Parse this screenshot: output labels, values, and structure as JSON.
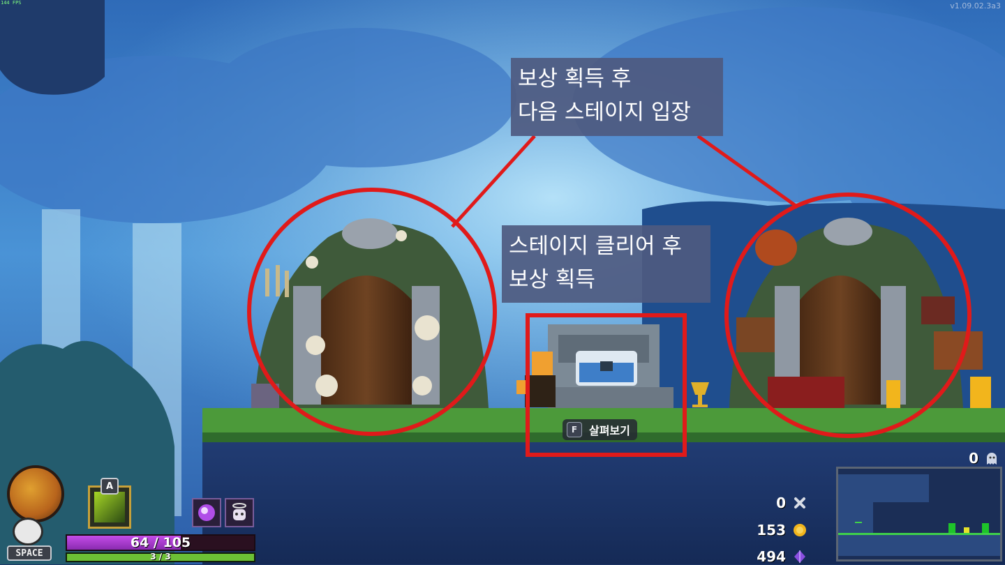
{
  "hud": {
    "fps": "144 FPS",
    "version": "v1.09.02.3a3",
    "skull_swap_key": "SPACE",
    "skill_key": "A",
    "hp": {
      "current": 64,
      "max": 105,
      "text": "64 / 105"
    },
    "shield": {
      "current": 3,
      "max": 3,
      "text": "3 / 3"
    },
    "enemy_count": "0",
    "currencies": {
      "bones": "0",
      "gold": "153",
      "dark_quartz": "494"
    }
  },
  "annotations": {
    "top_callout": {
      "line1": "보상 획득 후",
      "line2": "다음 스테이지 입장"
    },
    "middle_callout": {
      "line1": "스테이지 클리어 후",
      "line2": "보상 획득"
    },
    "highlight_color": "#e01a1a"
  },
  "interaction": {
    "key": "F",
    "label": "살펴보기"
  },
  "colors": {
    "sky_top": "#3a7cc8",
    "sky_glow": "#9fd7f0",
    "ground_grass": "#4c9a3a",
    "ground_dark": "#233a6a",
    "hp_purple": "#a83ad4",
    "shield_green": "#6cc035",
    "gold": "#f2b51c",
    "quartz": "#8a4fe0"
  }
}
